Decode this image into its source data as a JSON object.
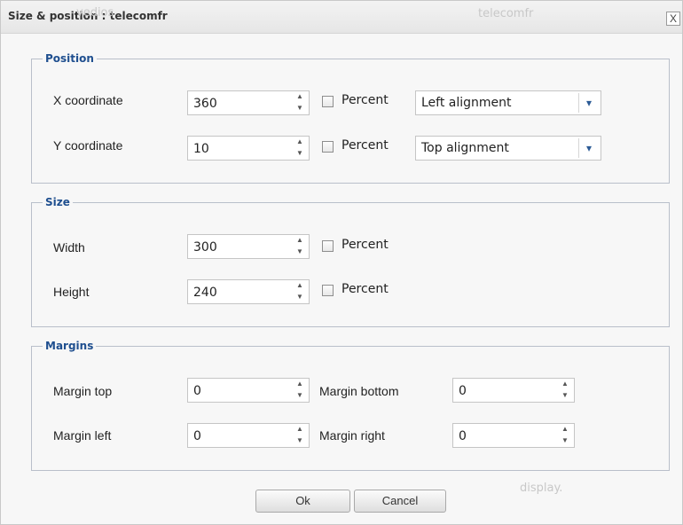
{
  "background": {
    "header_text_left": "vedios",
    "header_text_center": "telecomfr",
    "footer_text": "display."
  },
  "dialog": {
    "title": "Size & position : telecomfr",
    "close_label": "X"
  },
  "position": {
    "legend": "Position",
    "x": {
      "label": "X coordinate",
      "value": "360",
      "percent_label": "Percent",
      "alignment": "Left alignment"
    },
    "y": {
      "label": "Y coordinate",
      "value": "10",
      "percent_label": "Percent",
      "alignment": "Top alignment"
    }
  },
  "size": {
    "legend": "Size",
    "width": {
      "label": "Width",
      "value": "300",
      "percent_label": "Percent"
    },
    "height": {
      "label": "Height",
      "value": "240",
      "percent_label": "Percent"
    }
  },
  "margins": {
    "legend": "Margins",
    "top": {
      "label": "Margin top",
      "value": "0"
    },
    "bottom": {
      "label": "Margin bottom",
      "value": "0"
    },
    "left": {
      "label": "Margin left",
      "value": "0"
    },
    "right": {
      "label": "Margin right",
      "value": "0"
    }
  },
  "buttons": {
    "ok": "Ok",
    "cancel": "Cancel"
  },
  "icons": {
    "spinner_up": "▲",
    "spinner_down": "▼",
    "dropdown": "▾"
  }
}
